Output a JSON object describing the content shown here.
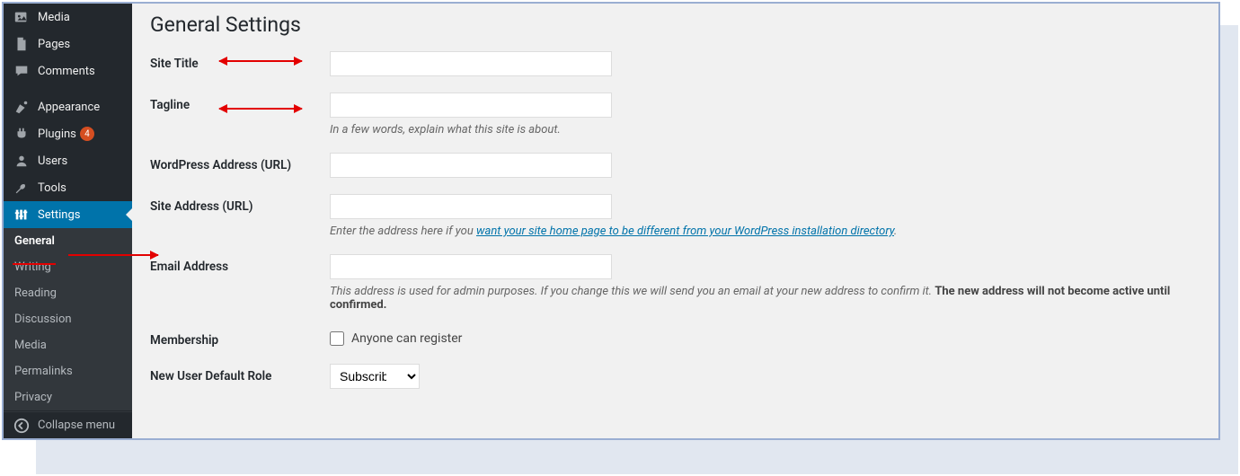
{
  "sidebar": {
    "items": [
      {
        "label": "Media",
        "icon": "media-icon"
      },
      {
        "label": "Pages",
        "icon": "pages-icon"
      },
      {
        "label": "Comments",
        "icon": "comments-icon"
      },
      {
        "label": "Appearance",
        "icon": "appearance-icon"
      },
      {
        "label": "Plugins",
        "icon": "plugins-icon",
        "badge": "4"
      },
      {
        "label": "Users",
        "icon": "users-icon"
      },
      {
        "label": "Tools",
        "icon": "tools-icon"
      },
      {
        "label": "Settings",
        "icon": "settings-icon",
        "active": true
      }
    ],
    "sub": [
      {
        "label": "General",
        "current": true
      },
      {
        "label": "Writing"
      },
      {
        "label": "Reading"
      },
      {
        "label": "Discussion"
      },
      {
        "label": "Media"
      },
      {
        "label": "Permalinks"
      },
      {
        "label": "Privacy"
      }
    ],
    "collapse": "Collapse menu"
  },
  "page": {
    "heading": "General Settings",
    "fields": {
      "site_title": {
        "label": "Site Title",
        "value": ""
      },
      "tagline": {
        "label": "Tagline",
        "value": "",
        "desc": "In a few words, explain what this site is about."
      },
      "wp_url": {
        "label": "WordPress Address (URL)",
        "value": ""
      },
      "site_url": {
        "label": "Site Address (URL)",
        "value": "",
        "desc_before": "Enter the address here if you ",
        "desc_link": "want your site home page to be different from your WordPress installation directory",
        "desc_after": "."
      },
      "email": {
        "label": "Email Address",
        "value": "",
        "desc_plain": "This address is used for admin purposes. If you change this we will send you an email at your new address to confirm it. ",
        "desc_bold": "The new address will not become active until confirmed."
      },
      "membership": {
        "label": "Membership",
        "checkbox_label": "Anyone can register",
        "checked": false
      },
      "default_role": {
        "label": "New User Default Role",
        "selected": "Subscriber"
      }
    }
  }
}
